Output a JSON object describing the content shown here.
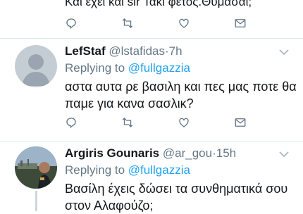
{
  "top_tweet": {
    "text_partial": "Και έχει και sir Τάκι φέτος.Θυμάσαι;"
  },
  "tweets": [
    {
      "name": "LefStaf",
      "handle": "@lstafidas",
      "dot": "·",
      "time": "7h",
      "reply_prefix": "Replying to",
      "reply_to": "@fullgazzia",
      "body": "αστα αυτα ρε βασιλη και πες μας ποτε θα παμε για κανα σασλικ?"
    },
    {
      "name": "Argiris Gounaris",
      "handle": "@ar_gou",
      "dot": "·",
      "time": "15h",
      "reply_prefix": "Replying to",
      "reply_to": "@fullgazzia",
      "body": "Βασίλη έχεις δώσει τα συνθηματικά σου στον Αλαφούζο;"
    }
  ],
  "icons": [
    "reply-icon",
    "retweet-icon",
    "like-icon",
    "dm-icon",
    "chevron-down-icon",
    "avatar-placeholder-icon"
  ],
  "colors": {
    "link": "#1da1f2",
    "secondary": "#657786",
    "text": "#14171a",
    "divider": "#e1e8ed"
  }
}
